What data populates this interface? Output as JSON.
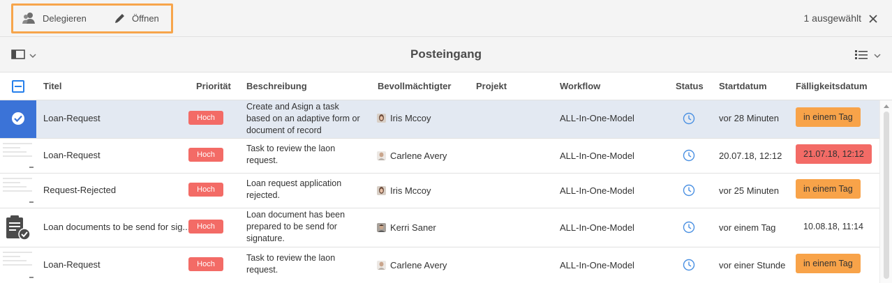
{
  "actionbar": {
    "delegate_label": "Delegieren",
    "open_label": "Öffnen",
    "selected_count": "1 ausgewählt",
    "highlight_color": "#f7a54b"
  },
  "header": {
    "title": "Posteingang"
  },
  "columns": {
    "title": "Titel",
    "priority": "Priorität",
    "description": "Beschreibung",
    "assignee": "Bevollmächtigter",
    "project": "Projekt",
    "workflow": "Workflow",
    "status": "Status",
    "start": "Startdatum",
    "due": "Fälligkeitsdatum"
  },
  "rows": [
    {
      "title": "Loan-Request",
      "priority": "Hoch",
      "description": "Create and Asign a task based on an adaptive form or document of record",
      "assignee": "Iris Mccoy",
      "project": "",
      "workflow": "ALL-In-One-Model",
      "start": "vor 28 Minuten",
      "due": "in einem Tag",
      "due_style": "orange",
      "selected": true
    },
    {
      "title": "Loan-Request",
      "priority": "Hoch",
      "description": "Task to review the laon request.",
      "assignee": "Carlene Avery",
      "project": "",
      "workflow": "ALL-In-One-Model",
      "start": "20.07.18, 12:12",
      "due": "21.07.18, 12:12",
      "due_style": "red",
      "selected": false
    },
    {
      "title": "Request-Rejected",
      "priority": "Hoch",
      "description": "Loan request application rejected.",
      "assignee": "Iris Mccoy",
      "project": "",
      "workflow": "ALL-In-One-Model",
      "start": "vor 25 Minuten",
      "due": "in einem Tag",
      "due_style": "orange",
      "selected": false
    },
    {
      "title": "Loan documents to be send for sig...",
      "priority": "Hoch",
      "description": "Loan document has been prepared to be send for signature.",
      "assignee": "Kerri Saner",
      "project": "",
      "workflow": "ALL-In-One-Model",
      "start": "vor einem Tag",
      "due": "10.08.18, 11:14",
      "due_style": "plain",
      "selected": false
    },
    {
      "title": "Loan-Request",
      "priority": "Hoch",
      "description": "Task to review the laon request.",
      "assignee": "Carlene Avery",
      "project": "",
      "workflow": "ALL-In-One-Model",
      "start": "vor einer Stunde",
      "due": "in einem Tag",
      "due_style": "orange",
      "selected": false
    }
  ],
  "colors": {
    "accent_blue": "#2680eb",
    "selection_blue": "#3b73d7",
    "priority_red": "#f36b66",
    "due_orange": "#f8a349",
    "status_icon_blue": "#4a90e2"
  }
}
